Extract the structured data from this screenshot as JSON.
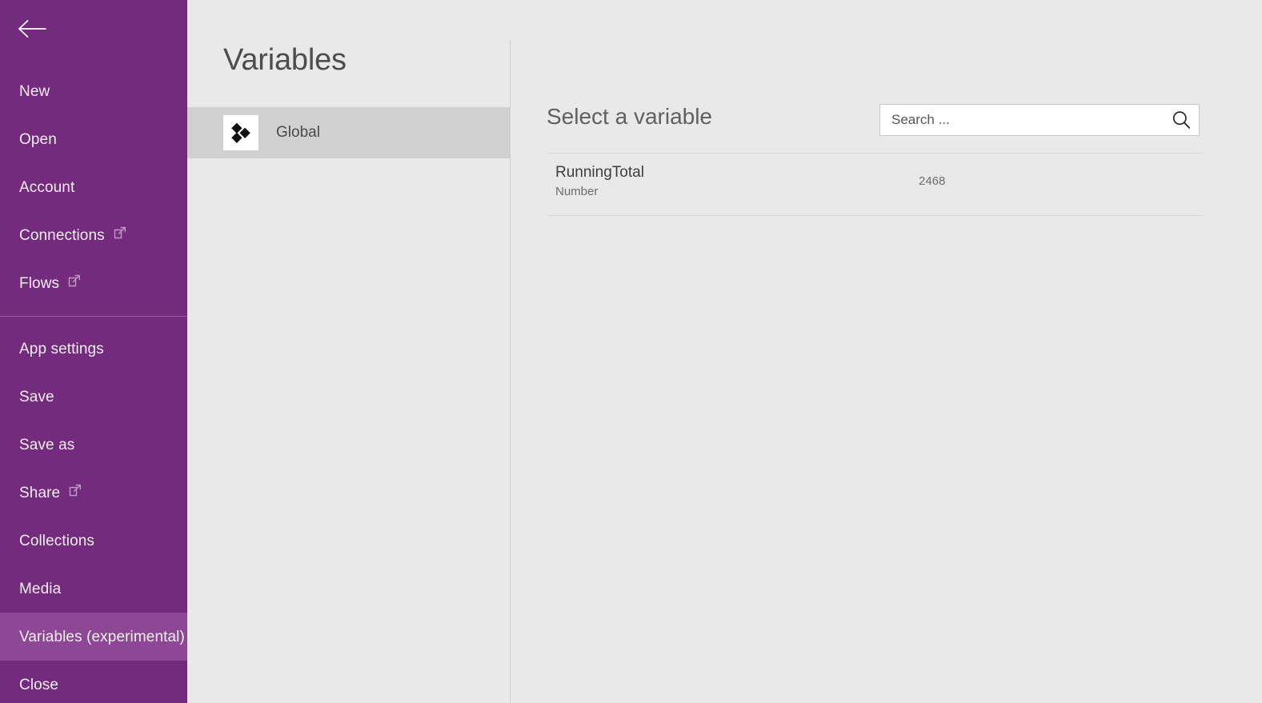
{
  "colors": {
    "sidebar_purple": "#752b7d",
    "sidebar_selected_purple": "#8e4795",
    "sidebar_divider": "#9a5ca0",
    "panel_background": "#e9e9e9",
    "scope_row_highlight": "#d1d1d1",
    "rule": "#d6d6d6"
  },
  "sidebar": {
    "back_button": {
      "icon": "back-arrow-icon",
      "label": "Back"
    },
    "groups": [
      {
        "items": [
          {
            "label": "New",
            "icon": null,
            "selected": false
          },
          {
            "label": "Open",
            "icon": null,
            "selected": false
          },
          {
            "label": "Account",
            "icon": null,
            "selected": false
          },
          {
            "label": "Connections",
            "icon": "external-link-icon",
            "selected": false
          },
          {
            "label": "Flows",
            "icon": "external-link-icon",
            "selected": false
          }
        ]
      },
      {
        "items": [
          {
            "label": "App settings",
            "icon": null,
            "selected": false
          },
          {
            "label": "Save",
            "icon": null,
            "selected": false
          },
          {
            "label": "Save as",
            "icon": null,
            "selected": false
          },
          {
            "label": "Share",
            "icon": "external-link-icon",
            "selected": false
          },
          {
            "label": "Collections",
            "icon": null,
            "selected": false
          },
          {
            "label": "Media",
            "icon": null,
            "selected": false
          },
          {
            "label": "Variables (experimental)",
            "icon": null,
            "selected": true
          },
          {
            "label": "Close",
            "icon": null,
            "selected": false
          }
        ]
      }
    ]
  },
  "variables_panel": {
    "title": "Variables",
    "scopes": [
      {
        "label": "Global",
        "icon": "global-variable-diamonds-icon",
        "selected": true
      }
    ]
  },
  "main": {
    "heading": "Select a variable",
    "search": {
      "placeholder": "Search ...",
      "value": "",
      "icon": "search-icon"
    },
    "variables": [
      {
        "name": "RunningTotal",
        "type": "Number",
        "value": "2468"
      }
    ]
  }
}
